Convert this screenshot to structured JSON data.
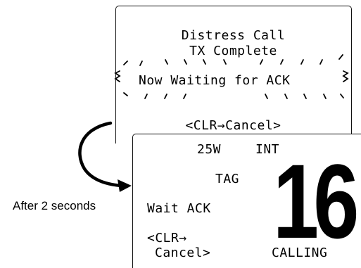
{
  "screen1": {
    "line1": "Distress Call",
    "line2": "TX Complete",
    "line3": "Now Waiting for ACK",
    "line4": "<CLR→Cancel>"
  },
  "screen2": {
    "power": "25W",
    "mode": "INT",
    "tag": "TAG",
    "status": "Wait ACK",
    "softkey_line1": "<CLR→",
    "softkey_line2": "Cancel>",
    "channel": "16",
    "calling": "CALLING"
  },
  "transition": {
    "caption": "After 2 seconds",
    "arrow_icon": "curved-arrow-icon",
    "blink_icon": "blink-marks-icon"
  }
}
